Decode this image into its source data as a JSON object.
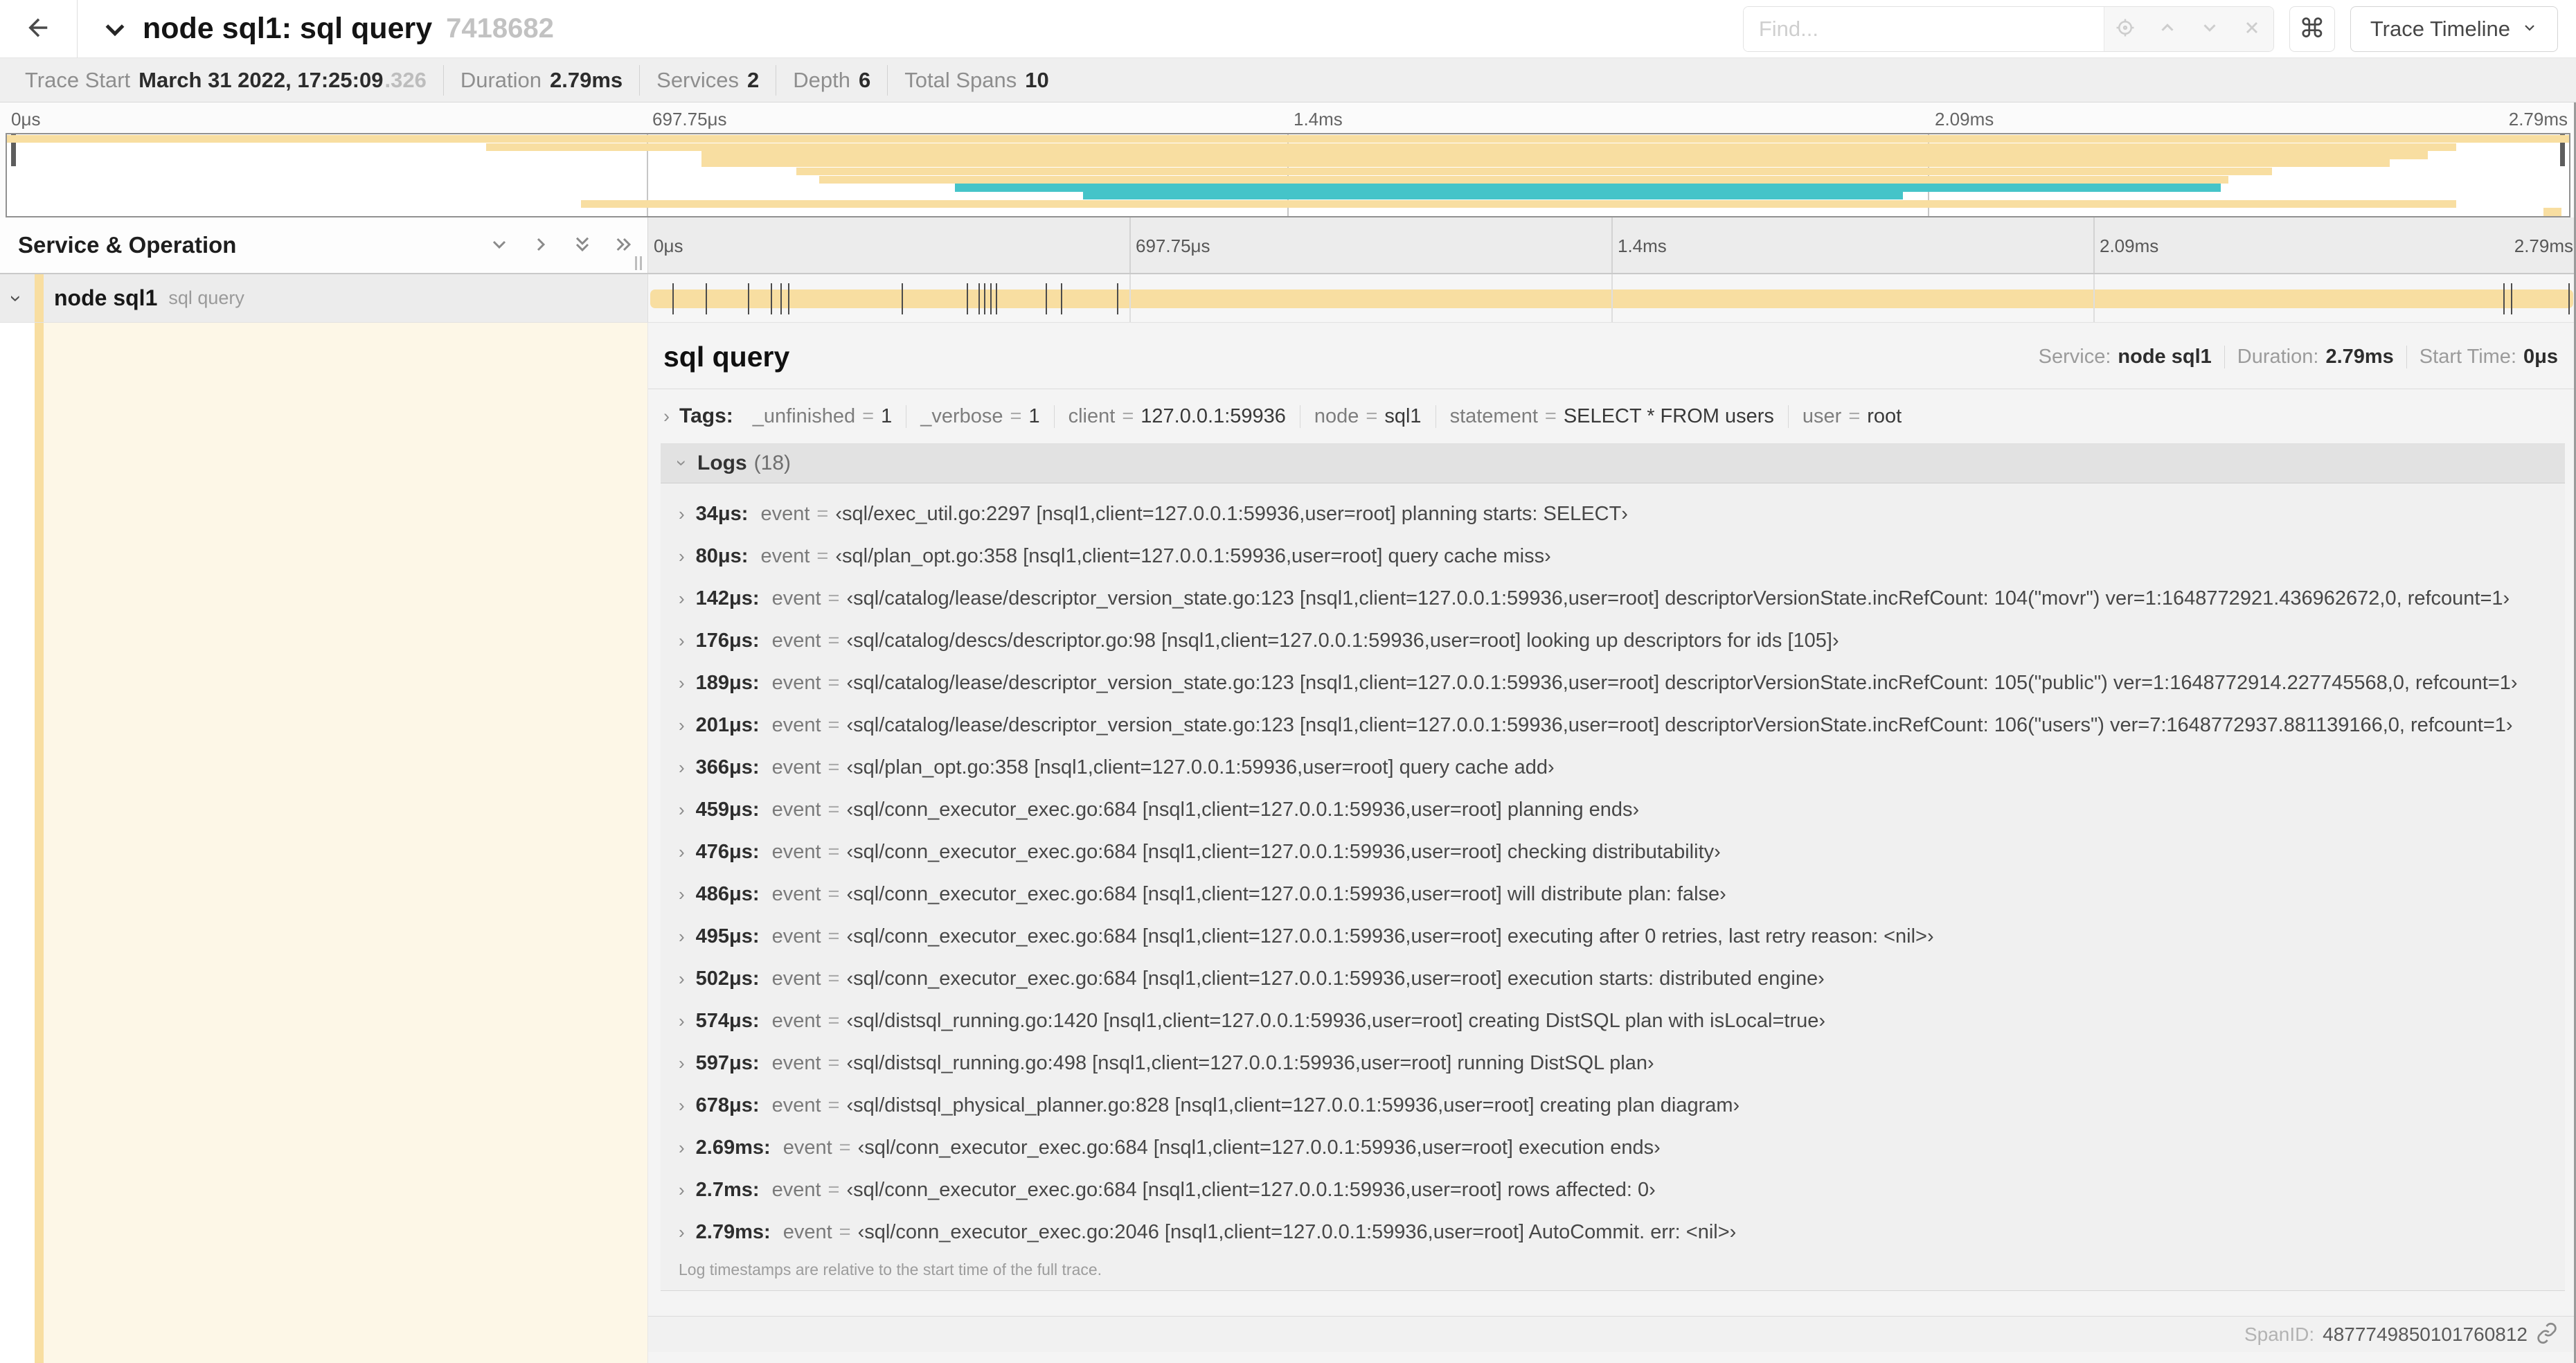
{
  "colors": {
    "tan": "#F8DEA1",
    "teal": "#45C4C9",
    "cream": "#FDF7E7"
  },
  "misc": {
    "chevron": "›",
    "equals": "="
  },
  "navbar": {
    "title": "node sql1: sql query",
    "trace_id": "7418682",
    "find_placeholder": "Find...",
    "shortcut_icon": "⌘",
    "view_selector": "Trace Timeline"
  },
  "trace_info": {
    "items": [
      {
        "label": "Trace Start",
        "value": "March 31 2022, 17:25:09",
        "suffix": ".326"
      },
      {
        "label": "Duration",
        "value": "2.79ms"
      },
      {
        "label": "Services",
        "value": "2"
      },
      {
        "label": "Depth",
        "value": "6"
      },
      {
        "label": "Total Spans",
        "value": "10"
      }
    ]
  },
  "timeline": {
    "ticks": [
      {
        "label": "0μs",
        "pct": 0
      },
      {
        "label": "697.75μs",
        "pct": 25
      },
      {
        "label": "1.4ms",
        "pct": 50
      },
      {
        "label": "2.09ms",
        "pct": 75
      },
      {
        "label": "2.79ms",
        "pct": 100
      }
    ]
  },
  "minimap": {
    "spans": [
      {
        "color": "tan",
        "start": 0,
        "end": 100
      },
      {
        "color": "tan",
        "start": 18.7,
        "end": 95.6
      },
      {
        "color": "tan",
        "start": 27.1,
        "end": 94.5
      },
      {
        "color": "tan",
        "start": 27.1,
        "end": 93.0
      },
      {
        "color": "tan",
        "start": 30.8,
        "end": 88.4
      },
      {
        "color": "tan",
        "start": 31.7,
        "end": 86.7
      },
      {
        "color": "teal",
        "start": 37.0,
        "end": 86.4
      },
      {
        "color": "teal",
        "start": 42.0,
        "end": 74.0
      },
      {
        "color": "tan",
        "start": 22.4,
        "end": 95.6
      },
      {
        "color": "tan",
        "start": 99.0,
        "end": 99.7
      }
    ]
  },
  "timeline_header": {
    "left_title": "Service & Operation"
  },
  "span_row": {
    "service": "node sql1",
    "operation": "sql query"
  },
  "detail": {
    "operation": "sql query",
    "meta": [
      {
        "label": "Service:",
        "value": "node sql1"
      },
      {
        "label": "Duration:",
        "value": "2.79ms"
      },
      {
        "label": "Start Time:",
        "value": "0μs"
      }
    ],
    "tags_label": "Tags:",
    "tags": [
      {
        "key": "_unfinished",
        "value": "1"
      },
      {
        "key": "_verbose",
        "value": "1"
      },
      {
        "key": "client",
        "value": "127.0.0.1:59936"
      },
      {
        "key": "node",
        "value": "sql1"
      },
      {
        "key": "statement",
        "value": "SELECT * FROM users"
      },
      {
        "key": "user",
        "value": "root"
      }
    ],
    "logs_label": "Logs",
    "logs_count": "(18)",
    "logs": [
      {
        "t": "34μs:",
        "pct": 1.2,
        "field": "event",
        "value": "‹sql/exec_util.go:2297 [nsql1,client=127.0.0.1:59936,user=root] planning starts: SELECT›"
      },
      {
        "t": "80μs:",
        "pct": 2.9,
        "field": "event",
        "value": "‹sql/plan_opt.go:358 [nsql1,client=127.0.0.1:59936,user=root] query cache miss›"
      },
      {
        "t": "142μs:",
        "pct": 5.1,
        "field": "event",
        "value": "‹sql/catalog/lease/descriptor_version_state.go:123 [nsql1,client=127.0.0.1:59936,user=root] descriptorVersionState.incRefCount: 104(\"movr\") ver=1:1648772921.436962672,0, refcount=1›"
      },
      {
        "t": "176μs:",
        "pct": 6.3,
        "field": "event",
        "value": "‹sql/catalog/descs/descriptor.go:98 [nsql1,client=127.0.0.1:59936,user=root] looking up descriptors for ids [105]›"
      },
      {
        "t": "189μs:",
        "pct": 6.8,
        "field": "event",
        "value": "‹sql/catalog/lease/descriptor_version_state.go:123 [nsql1,client=127.0.0.1:59936,user=root] descriptorVersionState.incRefCount: 105(\"public\") ver=1:1648772914.227745568,0, refcount=1›"
      },
      {
        "t": "201μs:",
        "pct": 7.2,
        "field": "event",
        "value": "‹sql/catalog/lease/descriptor_version_state.go:123 [nsql1,client=127.0.0.1:59936,user=root] descriptorVersionState.incRefCount: 106(\"users\") ver=7:1648772937.881139166,0, refcount=1›"
      },
      {
        "t": "366μs:",
        "pct": 13.1,
        "field": "event",
        "value": "‹sql/plan_opt.go:358 [nsql1,client=127.0.0.1:59936,user=root] query cache add›"
      },
      {
        "t": "459μs:",
        "pct": 16.5,
        "field": "event",
        "value": "‹sql/conn_executor_exec.go:684 [nsql1,client=127.0.0.1:59936,user=root] planning ends›"
      },
      {
        "t": "476μs:",
        "pct": 17.1,
        "field": "event",
        "value": "‹sql/conn_executor_exec.go:684 [nsql1,client=127.0.0.1:59936,user=root] checking distributability›"
      },
      {
        "t": "486μs:",
        "pct": 17.4,
        "field": "event",
        "value": "‹sql/conn_executor_exec.go:684 [nsql1,client=127.0.0.1:59936,user=root] will distribute plan: false›"
      },
      {
        "t": "495μs:",
        "pct": 17.7,
        "field": "event",
        "value": "‹sql/conn_executor_exec.go:684 [nsql1,client=127.0.0.1:59936,user=root] executing after 0 retries, last retry reason: <nil>›"
      },
      {
        "t": "502μs:",
        "pct": 18.0,
        "field": "event",
        "value": "‹sql/conn_executor_exec.go:684 [nsql1,client=127.0.0.1:59936,user=root] execution starts: distributed engine›"
      },
      {
        "t": "574μs:",
        "pct": 20.6,
        "field": "event",
        "value": "‹sql/distsql_running.go:1420 [nsql1,client=127.0.0.1:59936,user=root] creating DistSQL plan with isLocal=true›"
      },
      {
        "t": "597μs:",
        "pct": 21.4,
        "field": "event",
        "value": "‹sql/distsql_running.go:498 [nsql1,client=127.0.0.1:59936,user=root] running DistSQL plan›"
      },
      {
        "t": "678μs:",
        "pct": 24.3,
        "field": "event",
        "value": "‹sql/distsql_physical_planner.go:828 [nsql1,client=127.0.0.1:59936,user=root] creating plan diagram›"
      },
      {
        "t": "2.69ms:",
        "pct": 96.4,
        "field": "event",
        "value": "‹sql/conn_executor_exec.go:684 [nsql1,client=127.0.0.1:59936,user=root] execution ends›"
      },
      {
        "t": "2.7ms:",
        "pct": 96.8,
        "field": "event",
        "value": "‹sql/conn_executor_exec.go:684 [nsql1,client=127.0.0.1:59936,user=root] rows affected: 0›"
      },
      {
        "t": "2.79ms:",
        "pct": 99.8,
        "field": "event",
        "value": "‹sql/conn_executor_exec.go:2046 [nsql1,client=127.0.0.1:59936,user=root] AutoCommit. err: <nil>›"
      }
    ],
    "note": "Log timestamps are relative to the start time of the full trace.",
    "footer": {
      "label": "SpanID:",
      "value": "4877749850101760812"
    }
  }
}
